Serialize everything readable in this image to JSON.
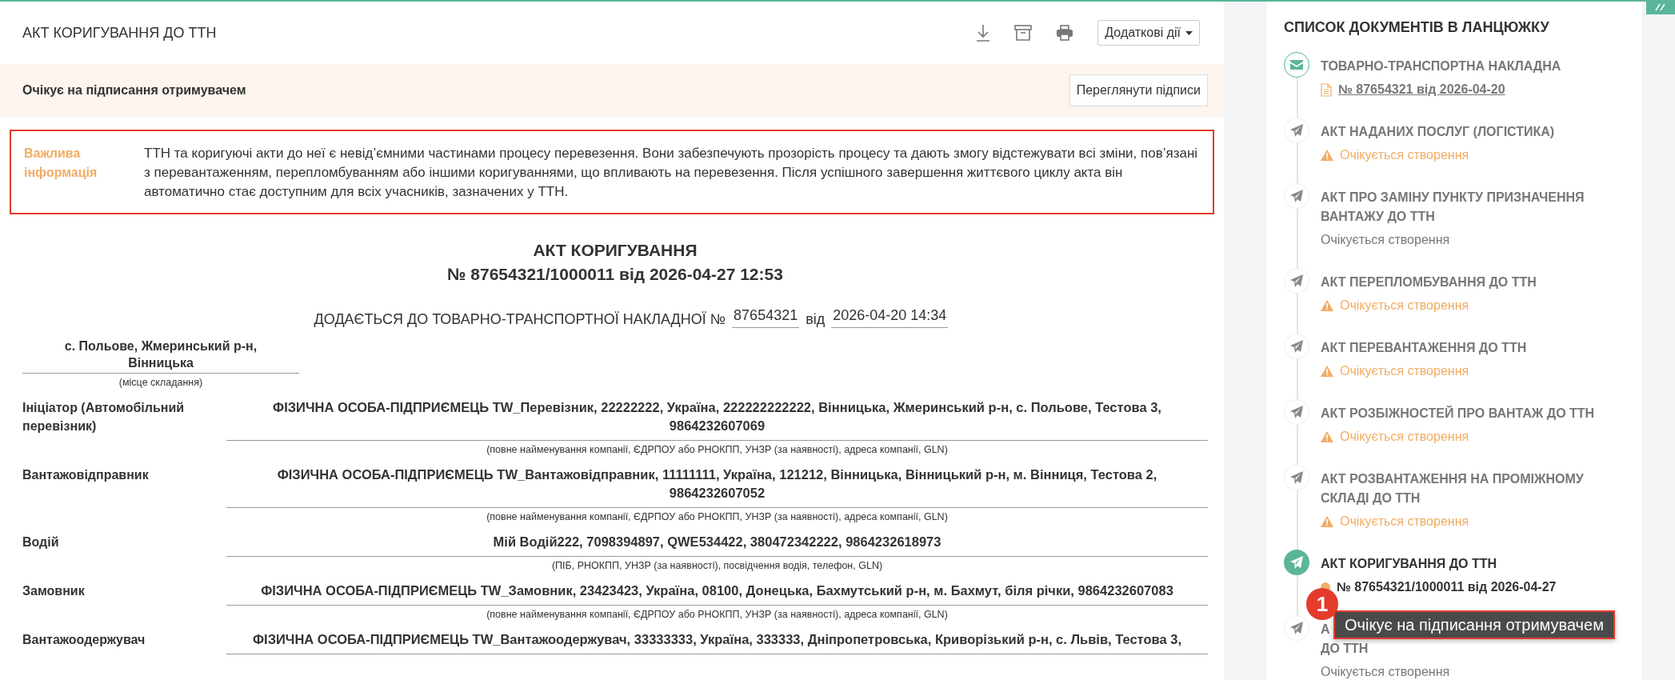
{
  "header": {
    "title": "АКТ КОРИГУВАННЯ ДО ТТН",
    "actions_menu": "Додаткові дії"
  },
  "status_bar": {
    "text": "Очікує на підписання отримувачем",
    "button": "Переглянути підписи"
  },
  "notice": {
    "label": "Важлива інформація",
    "text": "ТТН та коригуючі акти до неї є невід’ємними частинами процесу перевезення. Вони забезпечують прозорість процесу та дають змогу відстежувати всі зміни, пов’язані з перевантаженням, перепломбуванням або іншими коригуваннями, що впливають на перевезення. Після успішного завершення життєвого циклу акта він автоматично стає доступним для всіх учасників, зазначених у ТТН."
  },
  "document": {
    "title": "АКТ КОРИГУВАННЯ",
    "number_line": "№ 87654321/1000011 від 2026-04-27 12:53",
    "attach_text": "ДОДАЄТЬСЯ ДО ТОВАРНО-ТРАНСПОРТНОЇ НАКЛАДНОЇ №",
    "waybill_number": "87654321",
    "date_label": "від",
    "waybill_date": "2026-04-20 14:34",
    "place": "с. Польове, Жмеринський р-н, Вінницька",
    "place_hint": "(місце складання)",
    "parties": [
      {
        "label": "Ініціатор (Автомобільний перевізник)",
        "value": "ФІЗИЧНА ОСОБА-ПІДПРИЄМЕЦЬ TW_Перевізник, 22222222, Україна, 222222222222, Вінницька, Жмеринський р-н, с. Польове, Тестова 3, 9864232607069",
        "hint": "(повне найменування компанії, ЄДРПОУ або РНОКПП, УНЗР (за наявності), адреса компанії, GLN)"
      },
      {
        "label": "Вантажовідправник",
        "value": "ФІЗИЧНА ОСОБА-ПІДПРИЄМЕЦЬ TW_Вантажовідправник, 11111111, Україна, 121212, Вінницька, Вінницький р-н, м. Вінниця, Тестова 2, 9864232607052",
        "hint": "(повне найменування компанії, ЄДРПОУ або РНОКПП, УНЗР (за наявності), адреса компанії, GLN)"
      },
      {
        "label": "Водій",
        "value": "Мій Водій222, 7098394897, QWE534422, 380472342222, 9864232618973",
        "hint": "(ПІБ, РНОКПП, УНЗР (за наявності), посвідчення водія, телефон, GLN)"
      },
      {
        "label": "Замовник",
        "value": "ФІЗИЧНА ОСОБА-ПІДПРИЄМЕЦЬ TW_Замовник, 23423423, Україна, 08100, Донецька, Бахмутський р-н, м. Бахмут, біля річки, 9864232607083",
        "hint": "(повне найменування компанії, ЄДРПОУ або РНОКПП, УНЗР (за наявності), адреса компанії, GLN)"
      },
      {
        "label": "Вантажоодержувач",
        "value": "ФІЗИЧНА ОСОБА-ПІДПРИЄМЕЦЬ TW_Вантажоодержувач, 33333333, Україна, 333333, Дніпропетровська, Криворізький р-н, с. Львів, Тестова 3,"
      }
    ]
  },
  "chain": {
    "title": "СПИСОК ДОКУМЕНТІВ В ЛАНЦЮЖКУ",
    "items": [
      {
        "kind": "completed",
        "title_lines": [
          "ТОВАРНО-ТРАНСПОРТНА НАКЛАДНА"
        ],
        "status": {
          "kind": "link",
          "text": " № 87654321 від 2026-04-20"
        }
      },
      {
        "kind": "pending",
        "title_lines": [
          "АКТ НАДАНИХ ПОСЛУГ (ЛОГІСТИКА)"
        ],
        "status": {
          "kind": "warning",
          "text": "Очікується створення"
        }
      },
      {
        "kind": "pending",
        "title_lines": [
          "АКТ ПРО ЗАМІНУ ПУНКТУ ПРИЗНАЧЕННЯ",
          "ВАНТАЖУ ДО ТТН"
        ],
        "status": {
          "kind": "plain",
          "text": "Очікується створення"
        }
      },
      {
        "kind": "pending",
        "title_lines": [
          "АКТ ПЕРЕПЛОМБУВАННЯ ДО ТТН"
        ],
        "status": {
          "kind": "warning",
          "text": "Очікується створення"
        }
      },
      {
        "kind": "pending",
        "title_lines": [
          "АКТ ПЕРЕВАНТАЖЕННЯ ДО ТТН"
        ],
        "status": {
          "kind": "warning",
          "text": "Очікується створення"
        }
      },
      {
        "kind": "pending",
        "title_lines": [
          "АКТ РОЗБІЖНОСТЕЙ ПРО ВАНТАЖ ДО ТТН"
        ],
        "status": {
          "kind": "warning",
          "text": "Очікується створення"
        }
      },
      {
        "kind": "pending",
        "title_lines": [
          "АКТ РОЗВАНТАЖЕННЯ НА ПРОМІЖНОМУ",
          "СКЛАДІ ДО ТТН"
        ],
        "status": {
          "kind": "warning",
          "text": "Очікується створення"
        }
      },
      {
        "kind": "current",
        "title_lines": [
          "АКТ КОРИГУВАННЯ ДО ТТН"
        ],
        "status": {
          "kind": "dot",
          "color": "#f0ad65",
          "text": "№ 87654321/1000011 від 2026-04-27"
        }
      },
      {
        "kind": "pending",
        "title_lines": [
          "А",
          "ДО ТТН"
        ],
        "status": {
          "kind": "plain",
          "text": "Очікується створення"
        }
      }
    ]
  },
  "callout": {
    "badge": "1",
    "text": "Очікує на підписання отримувачем"
  }
}
